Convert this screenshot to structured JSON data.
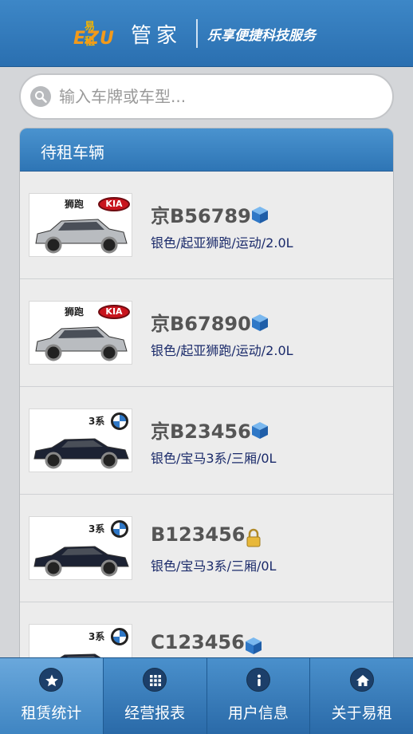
{
  "header": {
    "logo_small": "易租",
    "logo_brand": "EZU",
    "logo_title": "管家",
    "slogan": "乐享便捷科技服务"
  },
  "search": {
    "placeholder": "输入车牌或车型..."
  },
  "panel": {
    "title": "待租车辆"
  },
  "vehicles": [
    {
      "plate": "京B56789",
      "desc": "银色/起亚狮跑/运动/2.0L",
      "status_icon": "cube-icon",
      "brand_badge": "KIA",
      "model_label": "狮跑",
      "car_color": "#b9bcc0"
    },
    {
      "plate": "京B67890",
      "desc": "银色/起亚狮跑/运动/2.0L",
      "status_icon": "cube-icon",
      "brand_badge": "KIA",
      "model_label": "狮跑",
      "car_color": "#b9bcc0"
    },
    {
      "plate": "京B23456",
      "desc": "银色/宝马3系/三厢/0L",
      "status_icon": "cube-icon",
      "brand_badge": "BMW",
      "model_label": "3系",
      "car_color": "#1c2233"
    },
    {
      "plate": "B123456",
      "desc": "银色/宝马3系/三厢/0L",
      "status_icon": "lock-icon",
      "brand_badge": "BMW",
      "model_label": "3系",
      "car_color": "#1c2233"
    },
    {
      "plate": "C123456",
      "desc": "",
      "status_icon": "cube-icon",
      "brand_badge": "BMW",
      "model_label": "3系",
      "car_color": "#1c2233"
    }
  ],
  "tabs": [
    {
      "label": "租赁统计",
      "icon": "star-icon",
      "active": true
    },
    {
      "label": "经营报表",
      "icon": "grid-icon",
      "active": false
    },
    {
      "label": "用户信息",
      "icon": "info-icon",
      "active": false
    },
    {
      "label": "关于易租",
      "icon": "home-icon",
      "active": false
    }
  ],
  "colors": {
    "header_blue": "#2f78bc",
    "desc_text": "#1a2a6a",
    "plate_text": "#555555"
  }
}
